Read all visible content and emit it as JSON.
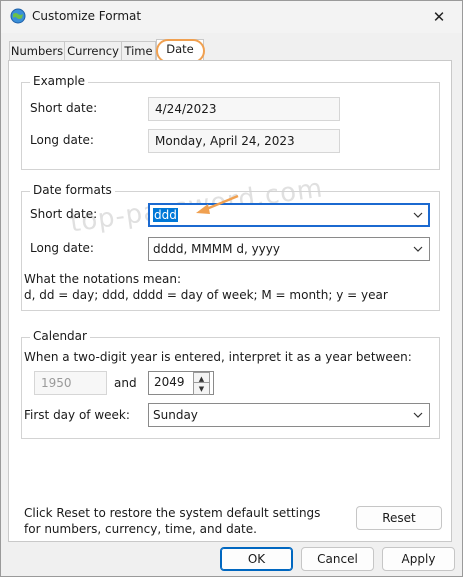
{
  "window": {
    "title": "Customize Format",
    "close_glyph": "✕"
  },
  "tabs": [
    {
      "label": "Numbers"
    },
    {
      "label": "Currency"
    },
    {
      "label": "Time"
    },
    {
      "label": "Date",
      "active": true
    }
  ],
  "watermark": "top-password.com",
  "example": {
    "legend": "Example",
    "short_label": "Short date:",
    "short_value": "4/24/2023",
    "long_label": "Long date:",
    "long_value": "Monday, April 24, 2023"
  },
  "formats": {
    "legend": "Date formats",
    "short_label": "Short date:",
    "short_value": "ddd",
    "long_label": "Long date:",
    "long_value": "dddd, MMMM d, yyyy",
    "notation_title": "What the notations mean:",
    "notation_text": "d, dd = day;  ddd, dddd = day of week;  M = month;  y = year"
  },
  "calendar": {
    "legend": "Calendar",
    "two_digit_text": "When a two-digit year is entered, interpret it as a year between:",
    "year_from": "1950",
    "and_label": "and",
    "year_to": "2049",
    "first_day_label": "First day of week:",
    "first_day_value": "Sunday"
  },
  "footer": {
    "reset_text": "Click Reset to restore the system default settings for numbers, currency, time, and date.",
    "reset_button": "Reset"
  },
  "buttons": {
    "ok": "OK",
    "cancel": "Cancel",
    "apply": "Apply"
  },
  "colors": {
    "accent": "#0078d7",
    "highlight": "#f0a050"
  }
}
